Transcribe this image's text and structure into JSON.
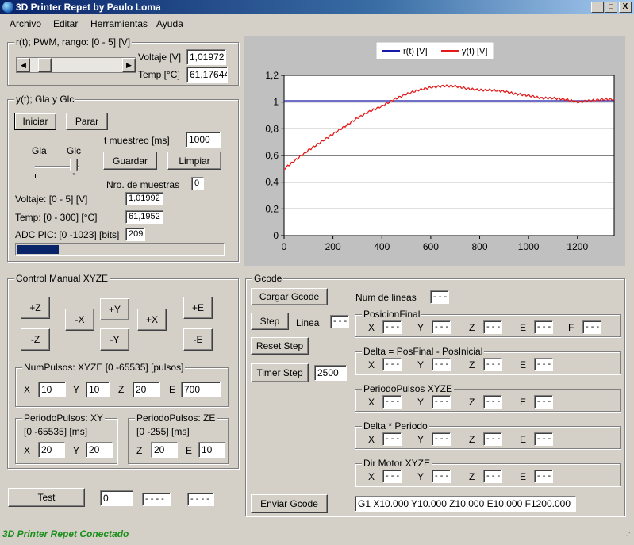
{
  "window": {
    "title": "3D Printer Repet by Paulo Loma",
    "controls": {
      "minimize": "_",
      "maximize": "□",
      "close": "X"
    }
  },
  "menu": [
    "Archivo",
    "Editar",
    "Herramientas",
    "Ayuda"
  ],
  "pwm": {
    "group_label": "r(t); PWM, rango: [0 - 5] [V]",
    "voltage_label": "Voltaje [V]",
    "voltage_value": "1,01972",
    "temp_label": "Temp [°C]",
    "temp_value": "61,17644",
    "slider_level": 0.1
  },
  "gla": {
    "group_label": "y(t); Gla y Glc",
    "start_button": "Iniciar",
    "stop_button": "Parar",
    "gla_label": "Gla",
    "glc_label": "Glc",
    "sample_time_label": "t muestreo [ms]",
    "sample_time_value": "1000",
    "save_button": "Guardar",
    "clear_button": "Limpiar",
    "samples_label": "Nro. de muestras",
    "samples_value": "0",
    "voltage_label": "Voltaje: [0 - 5] [V]",
    "voltage_value": "1,01992",
    "temp_label": "Temp: [0 - 300] [°C]",
    "temp_value": "61,1952",
    "adc_label": "ADC PIC: [0 -1023] [bits]",
    "adc_value": "209",
    "progress": 0.2
  },
  "chart_data": {
    "type": "line",
    "legend_placement": "top-center",
    "xlim": [
      0,
      1350
    ],
    "ylim": [
      0,
      1.2
    ],
    "x_ticks": [
      0,
      200,
      400,
      600,
      800,
      1000,
      1200
    ],
    "y_ticks": [
      "0",
      "0,2",
      "0,4",
      "0,6",
      "0,8",
      "1",
      "1,2"
    ],
    "y_tick_values": [
      0,
      0.2,
      0.4,
      0.6,
      0.8,
      1,
      1.2
    ],
    "grid": true,
    "series": [
      {
        "name": "r(t) [V]",
        "color": "#1a1aa8",
        "x": [
          0,
          1350
        ],
        "y": [
          1.01,
          1.01
        ]
      },
      {
        "name": "y(t) [V]",
        "color": "#e31a1a",
        "x": [
          0,
          50,
          100,
          150,
          200,
          250,
          300,
          350,
          400,
          450,
          500,
          550,
          600,
          650,
          700,
          750,
          800,
          850,
          900,
          950,
          1000,
          1050,
          1100,
          1150,
          1200,
          1250,
          1300,
          1350
        ],
        "y": [
          0.5,
          0.57,
          0.64,
          0.7,
          0.76,
          0.82,
          0.88,
          0.93,
          0.97,
          1.02,
          1.06,
          1.09,
          1.11,
          1.12,
          1.12,
          1.1,
          1.09,
          1.09,
          1.08,
          1.06,
          1.05,
          1.03,
          1.03,
          1.02,
          1.0,
          1.01,
          1.02,
          1.02
        ]
      }
    ]
  },
  "manual": {
    "group_label": "Control Manual XYZE",
    "btn_zp": "+Z",
    "btn_zm": "-Z",
    "btn_xm": "-X",
    "btn_yp": "+Y",
    "btn_ym": "-Y",
    "btn_xp": "+X",
    "btn_ep": "+E",
    "btn_em": "-E",
    "pulses_label": "NumPulsos: XYZE [0 -65535] [pulsos]",
    "x_label": "X",
    "x_value": "10",
    "y_label": "Y",
    "y_value": "10",
    "z_label": "Z",
    "z_value": "20",
    "e_label": "E",
    "e_value": "700",
    "period_xy_label": "PeriodoPulsos: XY",
    "period_xy_range": "[0 -65535] [ms]",
    "pxy_x_value": "20",
    "pxy_y_value": "20",
    "period_ze_label": "PeriodoPulsos: ZE",
    "period_ze_range": "[0 -255] [ms]",
    "pze_z_value": "20",
    "pze_e_value": "10"
  },
  "test": {
    "button": "Test",
    "value": "0",
    "field2": "- - - -",
    "field3": "- - - -"
  },
  "gcode": {
    "group_label": "Gcode",
    "load_button": "Cargar Gcode",
    "lines_label": "Num de lineas",
    "lines_value": "- - -",
    "step_button": "Step",
    "line_label": "Linea",
    "line_value": "- - -",
    "reset_button": "Reset Step",
    "timer_button": "Timer Step",
    "timer_value": "2500",
    "send_button": "Enviar Gcode",
    "command": "G1 X10.000 Y10.000 Z10.000 E10.000 F1200.000",
    "dash": "- - -",
    "axis_x": "X",
    "axis_y": "Y",
    "axis_z": "Z",
    "axis_e": "E",
    "axis_f": "F",
    "final_pos_label": "PosicionFinal",
    "delta_label": "Delta = PosFinal - PosInicial",
    "period_label": "PeriodoPulsos XYZE",
    "delta_period_label": "Delta * Periodo",
    "dir_label": "Dir Motor XYZE"
  },
  "status": {
    "text": "3D Printer Repet Conectado"
  }
}
